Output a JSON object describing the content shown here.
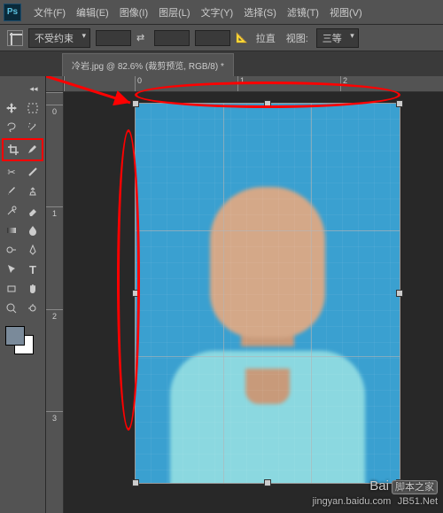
{
  "app": {
    "logo": "Ps"
  },
  "menu": [
    {
      "label": "文件(F)"
    },
    {
      "label": "编辑(E)"
    },
    {
      "label": "图像(I)"
    },
    {
      "label": "图层(L)"
    },
    {
      "label": "文字(Y)"
    },
    {
      "label": "选择(S)"
    },
    {
      "label": "滤镜(T)"
    },
    {
      "label": "视图(V)"
    }
  ],
  "options": {
    "constraint": "不受约束",
    "width": "",
    "height": "",
    "res": "",
    "straighten": "拉直",
    "view_label": "视图:",
    "grid_option": "三等"
  },
  "document": {
    "tab_title": "冷岩.jpg @ 82.6% (裁剪预览, RGB/8) *",
    "zoom": "82.6%"
  },
  "rulers": {
    "h": [
      "0",
      "1",
      "2"
    ],
    "v": [
      "0",
      "1",
      "2",
      "3"
    ]
  },
  "swatches": {
    "fg": "#7a8a9a",
    "bg": "#ffffff"
  },
  "watermark": {
    "main": "Bai",
    "brand": "脚本之家",
    "url": "JB51.Net",
    "sub": "jingyan.baidu.com"
  },
  "annotations": {
    "arrow_from": "crop-tool",
    "arrow_to": "canvas-corner",
    "ellipses": [
      "top-ruler-region",
      "left-ruler-region"
    ]
  }
}
